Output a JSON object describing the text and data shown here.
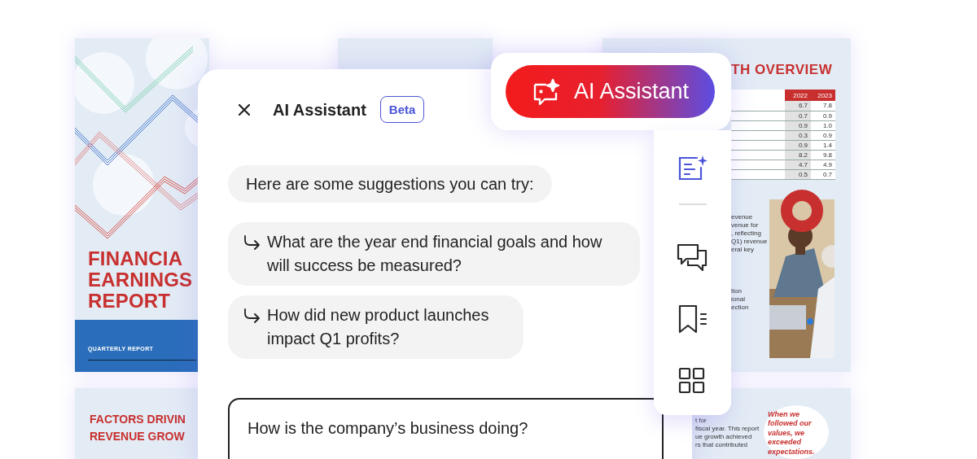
{
  "cover_document": {
    "title_lines": [
      "FINANCIA",
      "EARNINGS",
      "REPORT"
    ],
    "footer": "QUARTERLY REPORT"
  },
  "overview_document": {
    "title": "TH OVERVIEW",
    "table": {
      "columns": [
        "2022",
        "2023"
      ],
      "rows": [
        [
          "6.7",
          "7.8"
        ],
        [
          "0.7",
          "0.9"
        ],
        [
          "0.9",
          "1.0"
        ],
        [
          "0.3",
          "0.9"
        ],
        [
          "0.9",
          "1.4"
        ],
        [
          "8.2",
          "9.8"
        ],
        [
          "4.7",
          "4.9"
        ],
        [
          "0.5",
          "0.7"
        ]
      ]
    },
    "paragraph_1": "evenue\nvenue for\n, reflecting\nQ1) revenue\neral key",
    "paragraph_2": "tion\nional\nection"
  },
  "factors_document": {
    "title_lines": [
      "FACTORS DRIVIN",
      "REVENUE GROW"
    ]
  },
  "summary_document": {
    "paragraph": "t for\nfiscal year. This report\nue growth achieved\nrs that contributed",
    "quote": "When we\nfollowed our\nvalues, we\nexceeded\nexpectations."
  },
  "assistant_panel": {
    "title": "AI Assistant",
    "badge": "Beta",
    "intro": "Here are some suggestions you can try:",
    "suggestions": [
      "What are the year end financial goals and how will success be measured?",
      "How did new product launches impact Q1 profits?"
    ],
    "input": {
      "value": "How is the company’s business doing?"
    }
  },
  "assistant_button": {
    "label": "AI Assistant"
  },
  "tool_rail": {
    "items": [
      {
        "kind": "ai",
        "selected": true
      },
      {
        "kind": "comments",
        "selected": false
      },
      {
        "kind": "bookmarks",
        "selected": false
      },
      {
        "kind": "thumbnails",
        "selected": false
      }
    ]
  }
}
